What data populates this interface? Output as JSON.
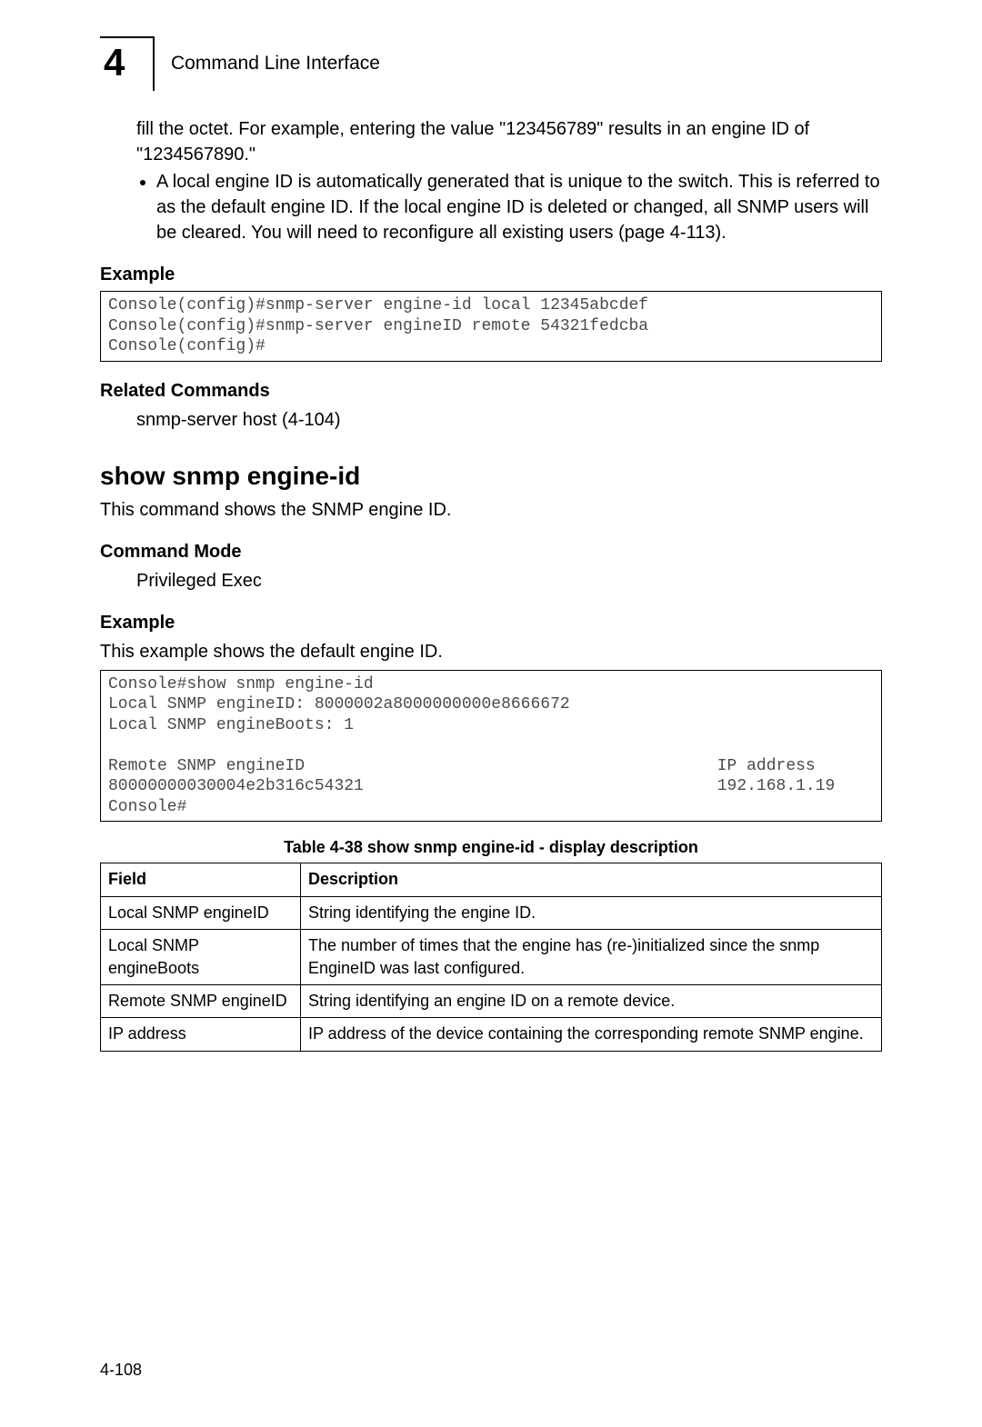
{
  "header": {
    "chapter_number": "4",
    "title": "Command Line Interface"
  },
  "top_paragraph": "fill the octet. For example, entering the value \"123456789\" results in an engine ID of  \"1234567890.\"",
  "bullet1": "A local engine ID is automatically generated that is unique to the switch. This is referred to as the default engine ID. If the local engine ID is deleted or changed, all SNMP users will be cleared. You will need to reconfigure all existing users (page 4-113).",
  "example1_heading": "Example",
  "example1_code": "Console(config)#snmp-server engine-id local 12345abcdef\nConsole(config)#snmp-server engineID remote 54321fedcba\nConsole(config)#",
  "related_heading": "Related Commands",
  "related_text": "snmp-server host (4-104)",
  "cmd_heading": "show snmp engine-id",
  "cmd_desc": "This command shows the SNMP engine ID.",
  "mode_heading": "Command Mode",
  "mode_text": "Privileged Exec",
  "example2_heading": "Example",
  "example2_intro": "This example shows the default engine ID.",
  "example2_code": "Console#show snmp engine-id\nLocal SNMP engineID: 8000002a8000000000e8666672\nLocal SNMP engineBoots: 1\n\nRemote SNMP engineID                                          IP address\n80000000030004e2b316c54321                                    192.168.1.19\nConsole#",
  "table_caption": "Table 4-38  show snmp engine-id - display description",
  "table": {
    "head_field": "Field",
    "head_desc": "Description",
    "rows": [
      {
        "field": "Local SNMP engineID",
        "desc": "String identifying the engine ID."
      },
      {
        "field": "Local SNMP engineBoots",
        "desc": "The number of times that the engine has (re-)initialized since the snmp EngineID was last configured."
      },
      {
        "field": "Remote SNMP engineID",
        "desc": "String identifying an engine ID on a remote device."
      },
      {
        "field": "IP address",
        "desc": "IP address of the device containing the corresponding remote SNMP engine."
      }
    ]
  },
  "page_number": "4-108"
}
